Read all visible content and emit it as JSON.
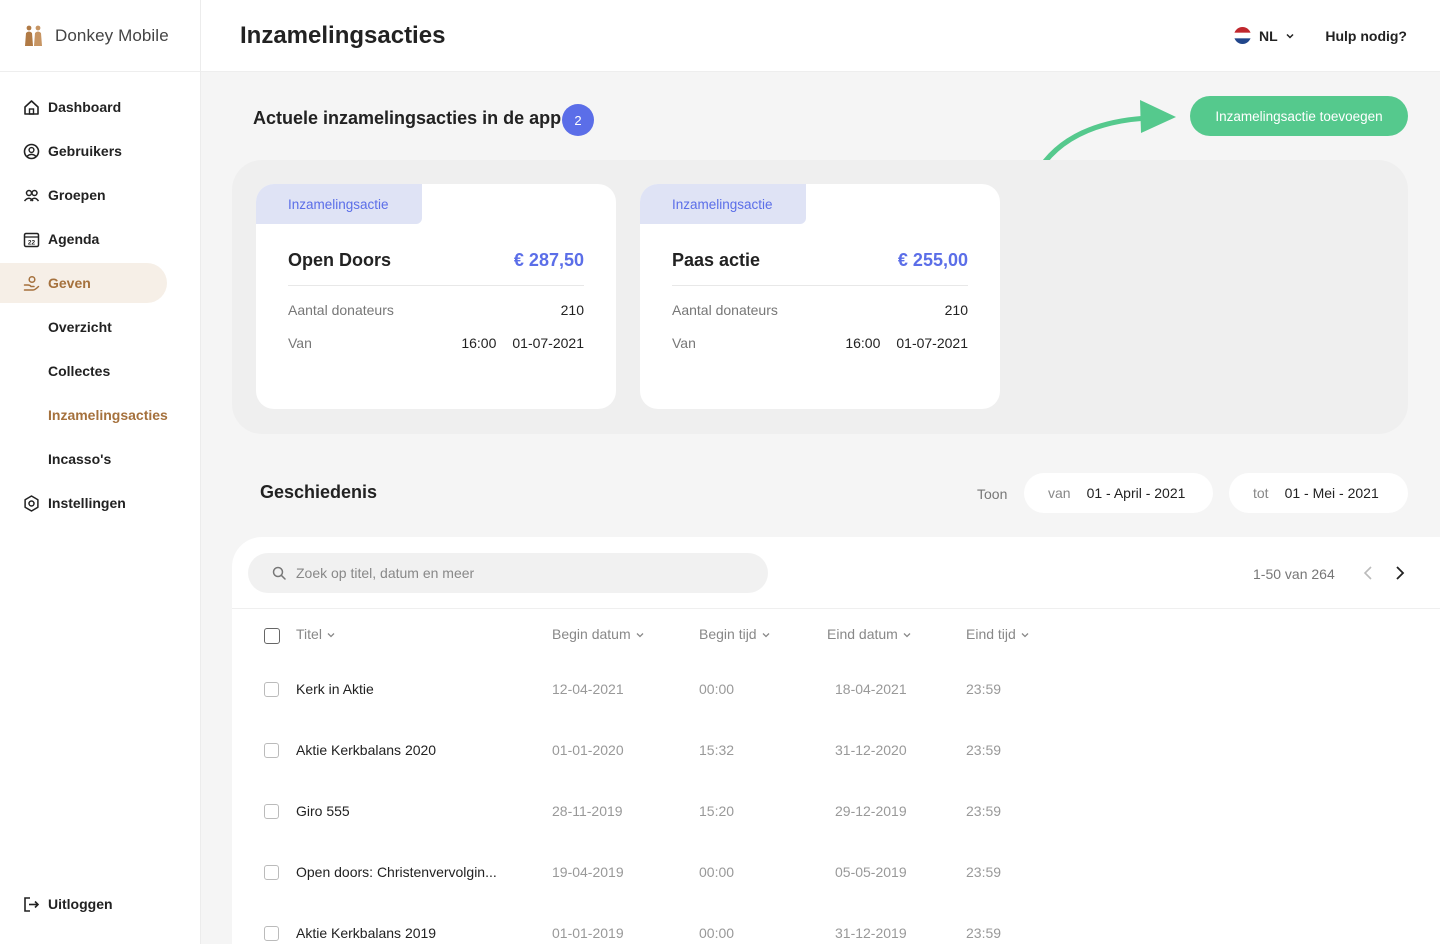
{
  "brand": {
    "name": "Donkey Mobile"
  },
  "sidebar": {
    "items": [
      {
        "label": "Dashboard",
        "icon": "home-icon"
      },
      {
        "label": "Gebruikers",
        "icon": "user-circle-icon"
      },
      {
        "label": "Groepen",
        "icon": "group-icon"
      },
      {
        "label": "Agenda",
        "icon": "calendar-icon"
      },
      {
        "label": "Geven",
        "icon": "give-hand-icon"
      }
    ],
    "sub_items": [
      "Overzicht",
      "Collectes",
      "Inzamelingsacties",
      "Incasso's"
    ],
    "settings": "Instellingen",
    "logout": "Uitloggen",
    "calendar_day": "22"
  },
  "header": {
    "title": "Inzamelingsacties",
    "language": "NL",
    "help": "Hulp nodig?"
  },
  "current": {
    "title": "Actuele inzamelingsacties in de app",
    "count": "2",
    "add_button": "Inzamelingsactie toevoegen",
    "cards": [
      {
        "tag": "Inzamelingsactie",
        "name": "Open Doors",
        "amount": "€ 287,50",
        "donors_label": "Aantal donateurs",
        "donors": "210",
        "from_label": "Van",
        "time": "16:00",
        "date": "01-07-2021"
      },
      {
        "tag": "Inzamelingsactie",
        "name": "Paas actie",
        "amount": "€ 255,00",
        "donors_label": "Aantal donateurs",
        "donors": "210",
        "from_label": "Van",
        "time": "16:00",
        "date": "01-07-2021"
      }
    ]
  },
  "history": {
    "title": "Geschiedenis",
    "show_label": "Toon",
    "from_label": "van",
    "from_value": "01 - April - 2021",
    "to_label": "tot",
    "to_value": "01 - Mei - 2021",
    "search_placeholder": "Zoek op titel, datum en meer",
    "pagination": "1-50 van 264",
    "columns": [
      "Titel",
      "Begin datum",
      "Begin tijd",
      "Eind datum",
      "Eind tijd"
    ],
    "rows": [
      {
        "title": "Kerk in Aktie",
        "begin_date": "12-04-2021",
        "begin_time": "00:00",
        "end_date": "18-04-2021",
        "end_time": "23:59"
      },
      {
        "title": "Aktie Kerkbalans 2020",
        "begin_date": "01-01-2020",
        "begin_time": "15:32",
        "end_date": "31-12-2020",
        "end_time": "23:59"
      },
      {
        "title": "Giro 555",
        "begin_date": "28-11-2019",
        "begin_time": "15:20",
        "end_date": "29-12-2019",
        "end_time": "23:59"
      },
      {
        "title": "Open doors: Christenvervolgin...",
        "begin_date": "19-04-2019",
        "begin_time": "00:00",
        "end_date": "05-05-2019",
        "end_time": "23:59"
      },
      {
        "title": "Aktie Kerkbalans 2019",
        "begin_date": "01-01-2019",
        "begin_time": "00:00",
        "end_date": "31-12-2019",
        "end_time": "23:59"
      }
    ]
  },
  "colors": {
    "accent": "#5b6ee8",
    "brand": "#a5713d",
    "success": "#55c98d"
  }
}
